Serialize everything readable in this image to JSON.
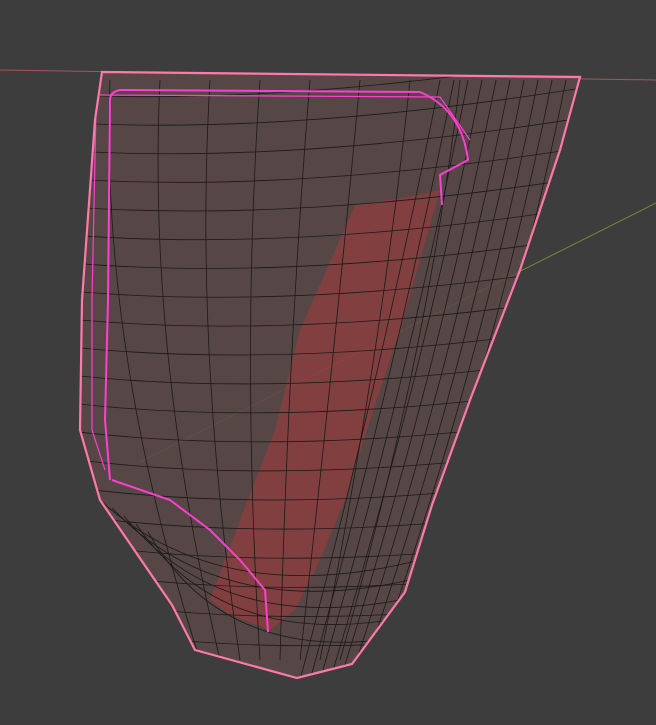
{
  "viewport": {
    "background_color": "#3d3d3d",
    "x_axis_color": "#a8555a",
    "y_axis_color": "#6f8a3a",
    "mesh_fill_color": "#5a4848",
    "wire_color": "#1a1a1a",
    "selected_edge_color": "#ff3fd0",
    "boundary_highlight_color": "#ff7aa8",
    "inner_face_color": "#a63a3a"
  }
}
